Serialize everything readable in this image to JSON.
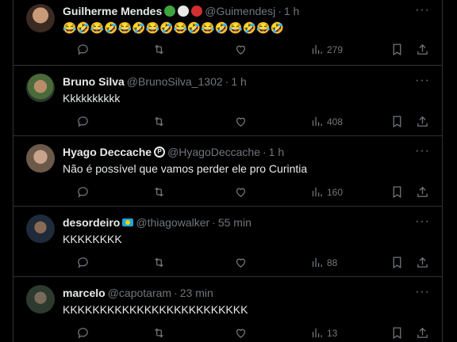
{
  "tweets": [
    {
      "name": "Guilherme Mendes",
      "handle": "@Guimendesj",
      "time": "1 h",
      "text": "😂🤣😂🤣😂🤣😂🤣😂🤣😂🤣😂🤣😂🤣",
      "views": "279",
      "badges": [
        "#3fa33f",
        "#e8e8e8",
        "#d32f2f"
      ]
    },
    {
      "name": "Bruno Silva",
      "handle": "@BrunoSilva_1302",
      "time": "1 h",
      "text": "Kkkkkkkkkk",
      "views": "408"
    },
    {
      "name": "Hyago Deccache",
      "verified_glyph": "P",
      "handle": "@HyagoDeccache",
      "time": "1 h",
      "text": "Não é possível que vamos perder ele pro Curintia",
      "views": "160"
    },
    {
      "name": "desordeiro",
      "handle": "@thiagowalker",
      "time": "55 min",
      "text": "KKKKKKKK",
      "views": "88"
    },
    {
      "name": "marcelo",
      "handle": "@capotaram",
      "time": "23 min",
      "text": "KKKKKKKKKKKKKKKKKKKKKKKKK",
      "views": "13"
    }
  ],
  "separator": "·",
  "more_glyph": "···"
}
